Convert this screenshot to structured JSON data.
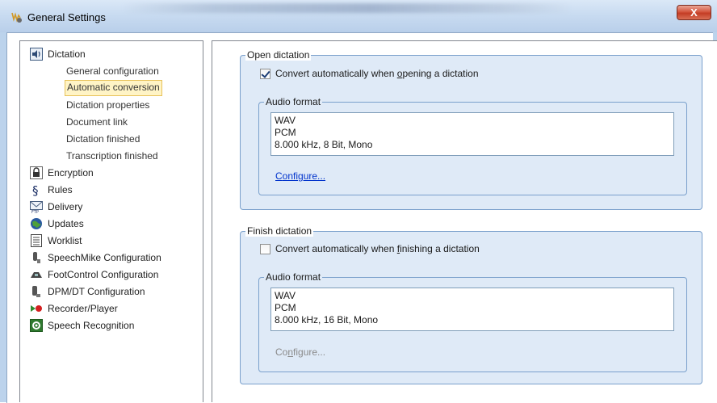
{
  "window": {
    "title": "General Settings",
    "close_glyph": "X"
  },
  "tree": {
    "dictation": {
      "label": "Dictation",
      "icon": "speaker-icon",
      "children": [
        "General configuration",
        "Automatic conversion",
        "Dictation properties",
        "Document link",
        "Dictation finished",
        "Transcription finished"
      ],
      "selected_index": 1
    },
    "items": [
      {
        "label": "Encryption",
        "icon": "lock-icon"
      },
      {
        "label": "Rules",
        "icon": "section-icon"
      },
      {
        "label": "Delivery",
        "icon": "ftp-mail-icon"
      },
      {
        "label": "Updates",
        "icon": "globe-icon"
      },
      {
        "label": "Worklist",
        "icon": "list-icon"
      },
      {
        "label": "SpeechMike Configuration",
        "icon": "microphone-icon"
      },
      {
        "label": "FootControl Configuration",
        "icon": "footcontrol-icon"
      },
      {
        "label": "DPM/DT Configuration",
        "icon": "recorder-device-icon"
      },
      {
        "label": "Recorder/Player",
        "icon": "record-play-icon"
      },
      {
        "label": "Speech Recognition",
        "icon": "speech-recognition-icon"
      }
    ]
  },
  "open_dictation": {
    "group_label": "Open dictation",
    "checkbox": {
      "label_pre": "Convert automatically when ",
      "label_ul": "o",
      "label_post": "pening a dictation",
      "checked": true
    },
    "audio_format": {
      "label": "Audio format",
      "lines": [
        "WAV",
        "PCM",
        "8.000 kHz, 8 Bit, Mono"
      ]
    },
    "configure": {
      "pre": "",
      "ul": "C",
      "post": "onfigure...",
      "enabled": true
    }
  },
  "finish_dictation": {
    "group_label": "Finish dictation",
    "checkbox": {
      "label_pre": "Convert automatically when ",
      "label_ul": "f",
      "label_post": "inishing a dictation",
      "checked": false
    },
    "audio_format": {
      "label": "Audio format",
      "lines": [
        "WAV",
        "PCM",
        "8.000 kHz, 16 Bit, Mono"
      ]
    },
    "configure": {
      "pre": "Co",
      "ul": "n",
      "post": "figure...",
      "enabled": false
    }
  },
  "colors": {
    "group_bg": "#dfeaf7",
    "group_border": "#7aa0cc",
    "selection_bg": "#fff4c6",
    "selection_border": "#e8c25a",
    "link": "#0033cc",
    "disabled": "#8a8a8a"
  }
}
